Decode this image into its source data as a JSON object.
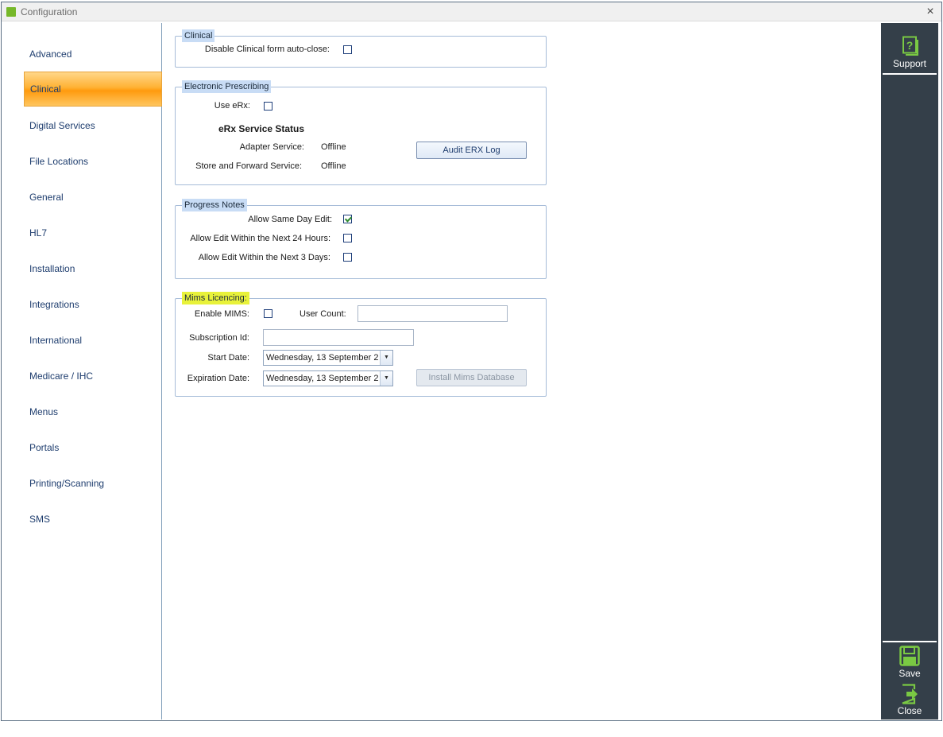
{
  "window": {
    "title": "Configuration",
    "close_glyph": "×"
  },
  "nav": {
    "items": [
      {
        "label": "Advanced"
      },
      {
        "label": "Clinical",
        "active": true
      },
      {
        "label": "Digital Services"
      },
      {
        "label": "File Locations"
      },
      {
        "label": "General"
      },
      {
        "label": "HL7"
      },
      {
        "label": "Installation"
      },
      {
        "label": "Integrations"
      },
      {
        "label": "International"
      },
      {
        "label": "Medicare / IHC"
      },
      {
        "label": "Menus"
      },
      {
        "label": "Portals"
      },
      {
        "label": "Printing/Scanning"
      },
      {
        "label": "SMS"
      }
    ]
  },
  "clinical": {
    "legend": "Clinical",
    "disable_autoclose_label": "Disable Clinical form auto-close:",
    "disable_autoclose_checked": false
  },
  "erx": {
    "legend": "Electronic Prescribing",
    "use_erx_label": "Use eRx:",
    "use_erx_checked": false,
    "status_heading": "eRx Service Status",
    "adapter_label": "Adapter Service:",
    "adapter_value": "Offline",
    "store_label": "Store and Forward Service:",
    "store_value": "Offline",
    "audit_button": "Audit ERX Log"
  },
  "progress_notes": {
    "legend": "Progress Notes",
    "same_day_label": "Allow Same Day Edit:",
    "same_day_checked": true,
    "next24_label": "Allow Edit Within the Next 24 Hours:",
    "next24_checked": false,
    "next3_label": "Allow Edit Within the Next 3 Days:",
    "next3_checked": false
  },
  "mims": {
    "legend": "Mims Licencing:",
    "enable_label": "Enable MIMS:",
    "enable_checked": false,
    "user_count_label": "User Count:",
    "user_count_value": "",
    "subscription_label": "Subscription Id:",
    "subscription_value": "",
    "start_label": "Start Date:",
    "start_value": "Wednesday, 13 September 2",
    "expiry_label": "Expiration Date:",
    "expiry_value": "Wednesday, 13 September 2",
    "install_button": "Install Mims Database"
  },
  "rightbar": {
    "support_label": "Support",
    "save_label": "Save",
    "close_label": "Close",
    "icon_color": "#7ac943"
  }
}
